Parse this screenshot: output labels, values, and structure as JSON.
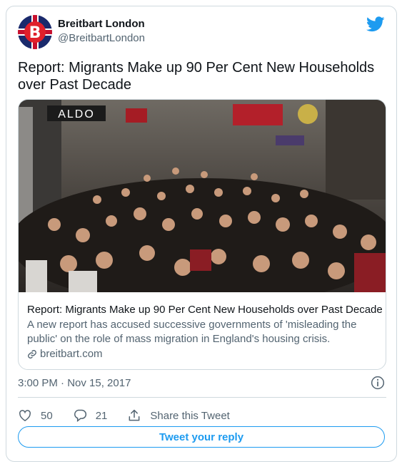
{
  "author": {
    "name": "Breitbart London",
    "handle": "@BreitbartLondon",
    "avatar_letter": "B"
  },
  "tweet": {
    "text": "Report: Migrants Make up 90 Per Cent New Households over Past Decade",
    "timestamp": "3:00 PM · Nov 15, 2017"
  },
  "link_card": {
    "image_sign": "ALDO",
    "title": "Report: Migrants Make up 90 Per Cent New Households over Past Decade",
    "description": "A new report has accused successive governments of 'misleading the public' on the role of mass migration in England's housing crisis.",
    "domain": "breitbart.com"
  },
  "actions": {
    "likes": "50",
    "replies": "21",
    "share_label": "Share this Tweet"
  },
  "reply_button": "Tweet your reply",
  "colors": {
    "accent": "#1d9bf0",
    "brand_red": "#e0202b",
    "brand_blue": "#1a2a6c"
  },
  "icons": [
    "twitter-bird-icon",
    "link-icon",
    "info-icon",
    "heart-icon",
    "reply-icon",
    "share-icon"
  ]
}
